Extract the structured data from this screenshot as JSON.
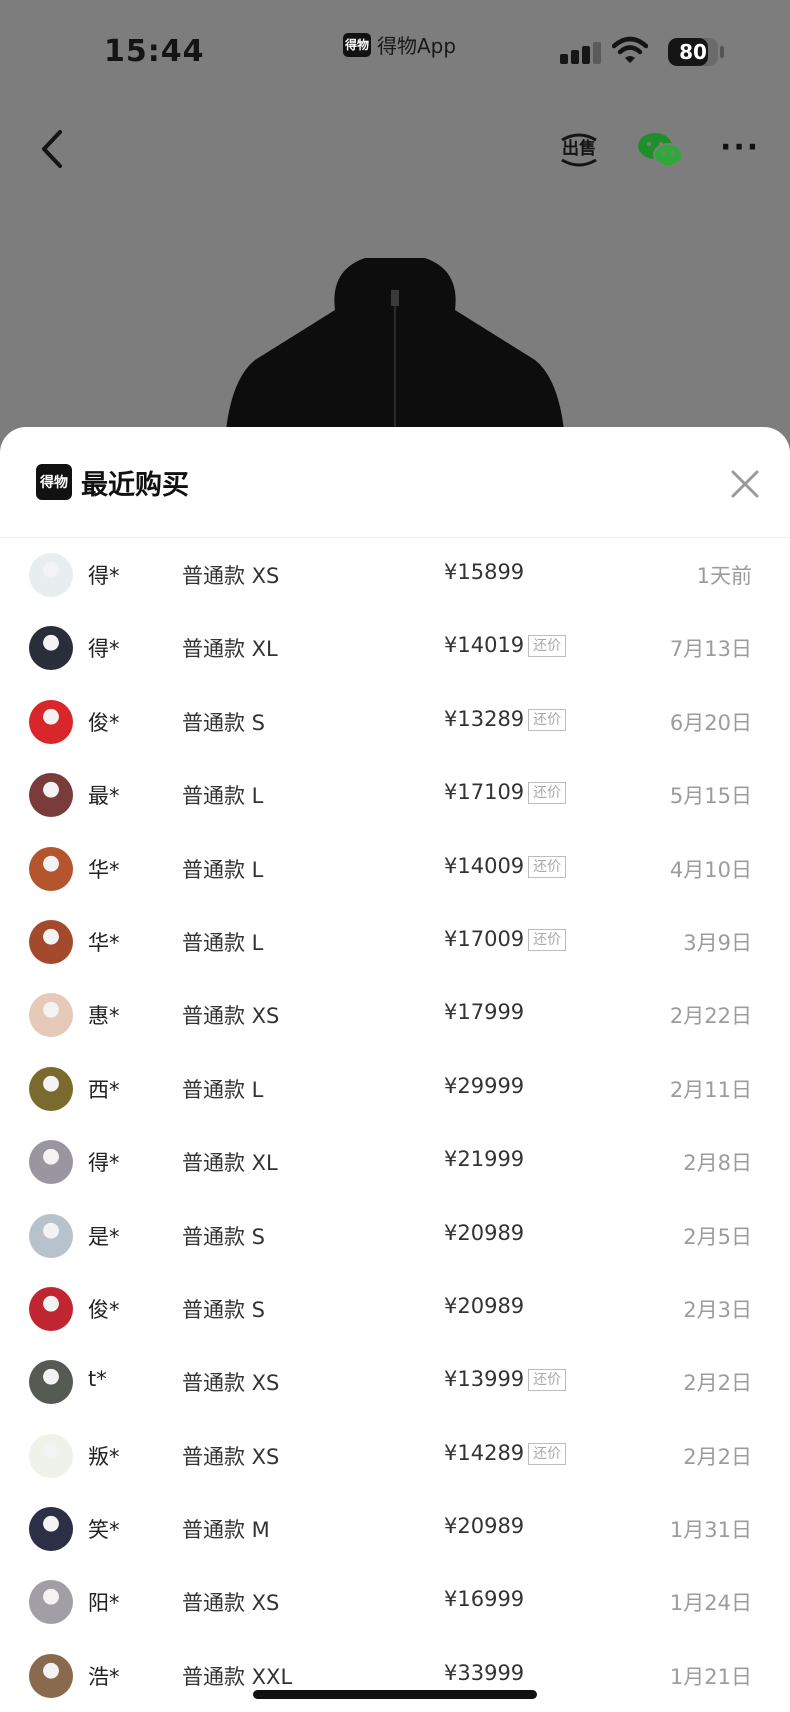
{
  "status_bar": {
    "time": "15:44",
    "app_logo_text": "得物",
    "app_name": "得物App",
    "battery": "80",
    "battery_level": 0.8
  },
  "nav": {
    "back_icon": "chevron-left-icon",
    "sell_label": "出售",
    "wechat_icon": "wechat-icon",
    "more_label": "···"
  },
  "sheet": {
    "logo_text": "得物",
    "title": "最近购买",
    "close_icon": "close-icon",
    "tag_label": "还价"
  },
  "purchases": [
    {
      "user": "得*",
      "variant": "普通款 XS",
      "price": "¥15899",
      "tag": "",
      "date": "1天前",
      "avatar_color": "#e8eef0"
    },
    {
      "user": "得*",
      "variant": "普通款 XL",
      "price": "¥14019",
      "tag": "还价",
      "date": "7月13日",
      "avatar_color": "#2a2d3a"
    },
    {
      "user": "俊*",
      "variant": "普通款 S",
      "price": "¥13289",
      "tag": "还价",
      "date": "6月20日",
      "avatar_color": "#d8262a"
    },
    {
      "user": "最*",
      "variant": "普通款 L",
      "price": "¥17109",
      "tag": "还价",
      "date": "5月15日",
      "avatar_color": "#7a3b3b"
    },
    {
      "user": "华*",
      "variant": "普通款 L",
      "price": "¥14009",
      "tag": "还价",
      "date": "4月10日",
      "avatar_color": "#b5552d"
    },
    {
      "user": "华*",
      "variant": "普通款 L",
      "price": "¥17009",
      "tag": "还价",
      "date": "3月9日",
      "avatar_color": "#a44a2c"
    },
    {
      "user": "惠*",
      "variant": "普通款 XS",
      "price": "¥17999",
      "tag": "",
      "date": "2月22日",
      "avatar_color": "#e6c9b8"
    },
    {
      "user": "西*",
      "variant": "普通款 L",
      "price": "¥29999",
      "tag": "",
      "date": "2月11日",
      "avatar_color": "#7a6a2e"
    },
    {
      "user": "得*",
      "variant": "普通款 XL",
      "price": "¥21999",
      "tag": "",
      "date": "2月8日",
      "avatar_color": "#9a96a0"
    },
    {
      "user": "是*",
      "variant": "普通款 S",
      "price": "¥20989",
      "tag": "",
      "date": "2月5日",
      "avatar_color": "#b8c2cc"
    },
    {
      "user": "俊*",
      "variant": "普通款 S",
      "price": "¥20989",
      "tag": "",
      "date": "2月3日",
      "avatar_color": "#c02632"
    },
    {
      "user": "t*",
      "variant": "普通款 XS",
      "price": "¥13999",
      "tag": "还价",
      "date": "2月2日",
      "avatar_color": "#555a52"
    },
    {
      "user": "叛*",
      "variant": "普通款 XS",
      "price": "¥14289",
      "tag": "还价",
      "date": "2月2日",
      "avatar_color": "#eef2e8"
    },
    {
      "user": "笑*",
      "variant": "普通款 M",
      "price": "¥20989",
      "tag": "",
      "date": "1月31日",
      "avatar_color": "#2c2f45"
    },
    {
      "user": "阳*",
      "variant": "普通款 XS",
      "price": "¥16999",
      "tag": "",
      "date": "1月24日",
      "avatar_color": "#a19ea6"
    },
    {
      "user": "浩*",
      "variant": "普通款 XXL",
      "price": "¥33999",
      "tag": "",
      "date": "1月21日",
      "avatar_color": "#8a6a4e"
    }
  ]
}
